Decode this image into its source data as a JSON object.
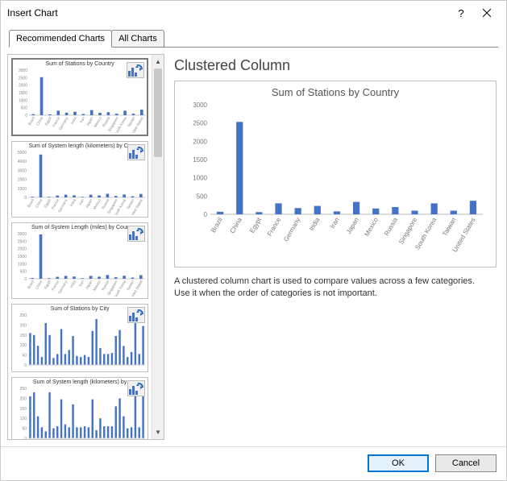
{
  "dialog": {
    "title": "Insert Chart",
    "help_tooltip": "Help",
    "close_tooltip": "Close"
  },
  "tabs": {
    "recommended": "Recommended Charts",
    "all": "All Charts"
  },
  "thumbs": {
    "t1": "Sum of Stations by Country",
    "t2": "Sum of System length (kilometers) by Co",
    "t3": "Sum of System Length (miles) by Cour",
    "t4": "Sum of Stations by City",
    "t5": "Sum of System length (kilometers) by"
  },
  "preview": {
    "heading": "Clustered Column",
    "chart_title": "Sum of Stations by Country",
    "desc_line1": "A clustered column chart is used to compare values across a few categories.",
    "desc_line2": "Use it when the order of categories is not important."
  },
  "footer": {
    "ok": "OK",
    "cancel": "Cancel"
  },
  "chart_data": {
    "type": "bar",
    "title": "Sum of Stations by Country",
    "ylabel": "",
    "xlabel": "",
    "ylim": [
      0,
      3000
    ],
    "yticks": [
      0,
      500,
      1000,
      1500,
      2000,
      2500,
      3000
    ],
    "categories": [
      "Brazil",
      "China",
      "Egypt",
      "France",
      "Germany",
      "India",
      "Iran",
      "Japan",
      "Mexico",
      "Russia",
      "Singapore",
      "South Korea",
      "Taiwan",
      "United States"
    ],
    "values": [
      70,
      2530,
      60,
      300,
      170,
      230,
      80,
      340,
      160,
      200,
      100,
      300,
      100,
      370
    ]
  },
  "thumb_data": {
    "categories": [
      "Brazil",
      "China",
      "Egypt",
      "France",
      "Germany",
      "India",
      "Iran",
      "Japan",
      "Mexico",
      "Russia",
      "Singapore",
      "South Korea",
      "Taiwan",
      "United States"
    ],
    "t1": {
      "ymax": 3000,
      "yticks": [
        0,
        500,
        1000,
        1500,
        2000,
        2500,
        3000
      ],
      "values": [
        70,
        2530,
        60,
        300,
        170,
        230,
        80,
        340,
        160,
        200,
        100,
        300,
        100,
        370
      ]
    },
    "t2": {
      "ymax": 5000,
      "yticks": [
        0,
        1000,
        2000,
        3000,
        4000,
        5000
      ],
      "values": [
        75,
        4750,
        60,
        210,
        300,
        230,
        60,
        300,
        220,
        400,
        160,
        320,
        130,
        380
      ]
    },
    "t3": {
      "ymax": 3000,
      "yticks": [
        0,
        500,
        1000,
        1500,
        2000,
        2500,
        3000
      ],
      "values": [
        50,
        2950,
        40,
        130,
        190,
        150,
        40,
        190,
        140,
        250,
        100,
        200,
        80,
        240
      ]
    },
    "t4_values": [
      160,
      150,
      96,
      40,
      210,
      150,
      35,
      55,
      180,
      55,
      75,
      145,
      45,
      40,
      50,
      40,
      170,
      230,
      85,
      55,
      55,
      60,
      145,
      175,
      95,
      40,
      65,
      215,
      55,
      195
    ],
    "t5_values": [
      210,
      230,
      110,
      55,
      35,
      230,
      50,
      60,
      195,
      70,
      55,
      170,
      55,
      55,
      60,
      55,
      195,
      40,
      100,
      60,
      60,
      60,
      160,
      200,
      110,
      50,
      55,
      210,
      55,
      215
    ]
  }
}
